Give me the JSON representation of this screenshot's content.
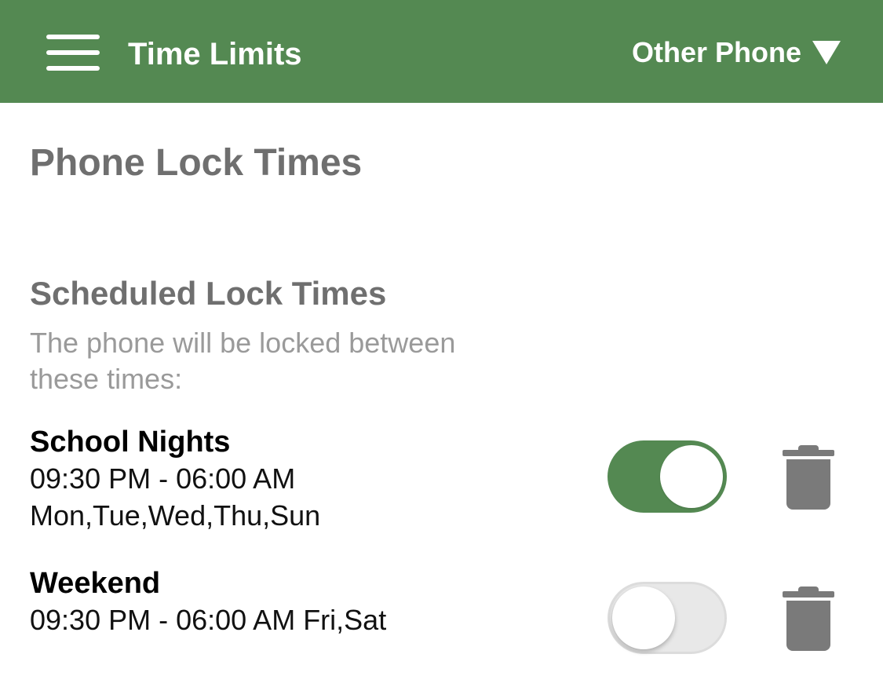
{
  "header": {
    "title": "Time Limits",
    "device_selector": "Other Phone",
    "background_color": "#548952"
  },
  "page": {
    "title": "Phone Lock Times"
  },
  "section": {
    "title": "Scheduled Lock Times",
    "description": "The phone will be locked between these times:"
  },
  "schedules": [
    {
      "name": "School Nights",
      "time_range": "09:30 PM - 06:00 AM",
      "days": "Mon,Tue,Wed,Thu,Sun",
      "enabled": true
    },
    {
      "name": "Weekend",
      "detail": "09:30 PM - 06:00 AM Fri,Sat",
      "enabled": false
    }
  ],
  "icons": {
    "menu": "hamburger-menu-icon",
    "dropdown": "caret-down-icon",
    "delete": "trash-icon"
  },
  "colors": {
    "accent": "#548952",
    "toggle_off": "#e8e8e8",
    "trash": "#7a7a7a"
  }
}
